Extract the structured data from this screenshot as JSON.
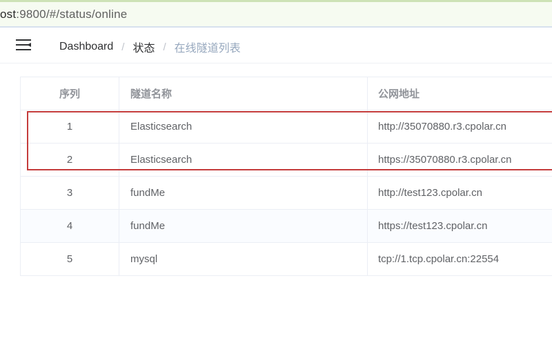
{
  "browser": {
    "url_host": "ost",
    "url_rest": ":9800/#/status/online"
  },
  "header": {
    "menu_icon": "hamburger-menu-icon",
    "breadcrumb": [
      {
        "label": "Dashboard"
      },
      {
        "label": "状态"
      },
      {
        "label": "在线隧道列表"
      }
    ],
    "separator": "/"
  },
  "table": {
    "columns": [
      "序列",
      "隧道名称",
      "公网地址"
    ],
    "rows": [
      {
        "index": "1",
        "name": "Elasticsearch",
        "url": "http://35070880.r3.cpolar.cn"
      },
      {
        "index": "2",
        "name": "Elasticsearch",
        "url": "https://35070880.r3.cpolar.cn"
      },
      {
        "index": "3",
        "name": "fundMe",
        "url": "http://test123.cpolar.cn"
      },
      {
        "index": "4",
        "name": "fundMe",
        "url": "https://test123.cpolar.cn"
      },
      {
        "index": "5",
        "name": "mysql",
        "url": "tcp://1.tcp.cpolar.cn:22554"
      }
    ]
  },
  "colors": {
    "highlight_border": "#c43b3b",
    "breadcrumb_current": "#97a8be"
  }
}
